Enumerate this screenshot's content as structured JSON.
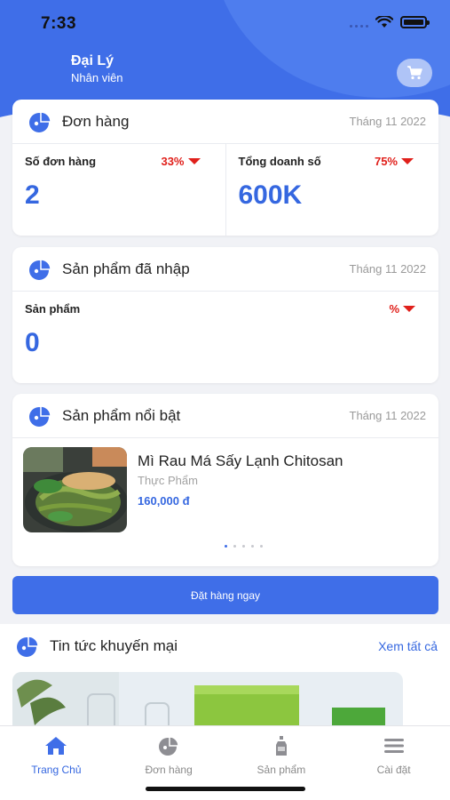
{
  "status_bar": {
    "time": "7:33"
  },
  "user": {
    "name": "Đại Lý",
    "role": "Nhân viên"
  },
  "orders_card": {
    "title": "Đơn hàng",
    "date": "Tháng 11 2022",
    "stats": [
      {
        "label": "Số đơn hàng",
        "percent": "33%",
        "value": "2"
      },
      {
        "label": "Tổng doanh số",
        "percent": "75%",
        "value": "600K"
      }
    ]
  },
  "imported_card": {
    "title": "Sản phẩm đã nhập",
    "date": "Tháng 11 2022",
    "stat": {
      "label": "Sản phẩm",
      "percent": "%",
      "value": "0"
    }
  },
  "featured_card": {
    "title": "Sản phẩm nổi bật",
    "date": "Tháng 11 2022",
    "product": {
      "name": "Mì Rau Má Sấy Lạnh Chitosan",
      "category": "Thực Phẩm",
      "price": "160,000 đ"
    },
    "carousel_pages": 5,
    "carousel_active": 0
  },
  "order_button": "Đặt hàng ngay",
  "news": {
    "title": "Tin tức khuyến mại",
    "see_all": "Xem tất cả"
  },
  "tabs": [
    {
      "label": "Trang Chủ",
      "icon": "home-icon"
    },
    {
      "label": "Đơn hàng",
      "icon": "pie-chart-icon"
    },
    {
      "label": "Sản phẩm",
      "icon": "bottle-icon"
    },
    {
      "label": "Cài đặt",
      "icon": "menu-icon"
    }
  ],
  "colors": {
    "primary": "#3f6ee8",
    "value_blue": "#3567e0",
    "negative": "#e0201b"
  }
}
